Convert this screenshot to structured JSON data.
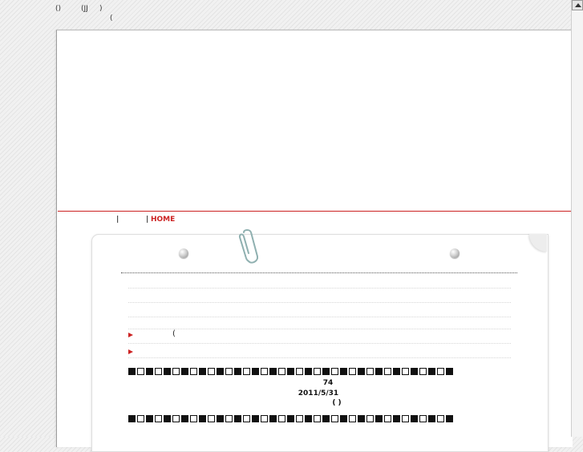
{
  "header": {
    "line1_a": "()",
    "line1_b": "(JJ",
    "line1_c": ")",
    "line2": "("
  },
  "nav": {
    "sep1": "|",
    "sep2": "|",
    "home_label": "HOME"
  },
  "card": {
    "item1_paren": "(",
    "count": "74",
    "date": "2011/5/31",
    "paren": "( )",
    "square_pattern": [
      1,
      0,
      1,
      0,
      1,
      0,
      1,
      0,
      1,
      0,
      1,
      0,
      1,
      0,
      1,
      0,
      1,
      0,
      1,
      0,
      1,
      0,
      1,
      0,
      1,
      0,
      1,
      0,
      1,
      0,
      1,
      0,
      1,
      0,
      1,
      0,
      1,
      0,
      1,
      0,
      1,
      0,
      1,
      0,
      1,
      0,
      1,
      0,
      1,
      0,
      1,
      0,
      1,
      0,
      1,
      0,
      1,
      0,
      1,
      0,
      1
    ]
  },
  "colors": {
    "accent": "#cc2222",
    "text": "#222222"
  },
  "icons": {
    "paperclip": "paperclip-icon",
    "pin": "pin-icon",
    "bullet": "triangle-bullet-icon",
    "scroll_up": "scroll-up-arrow-icon"
  }
}
